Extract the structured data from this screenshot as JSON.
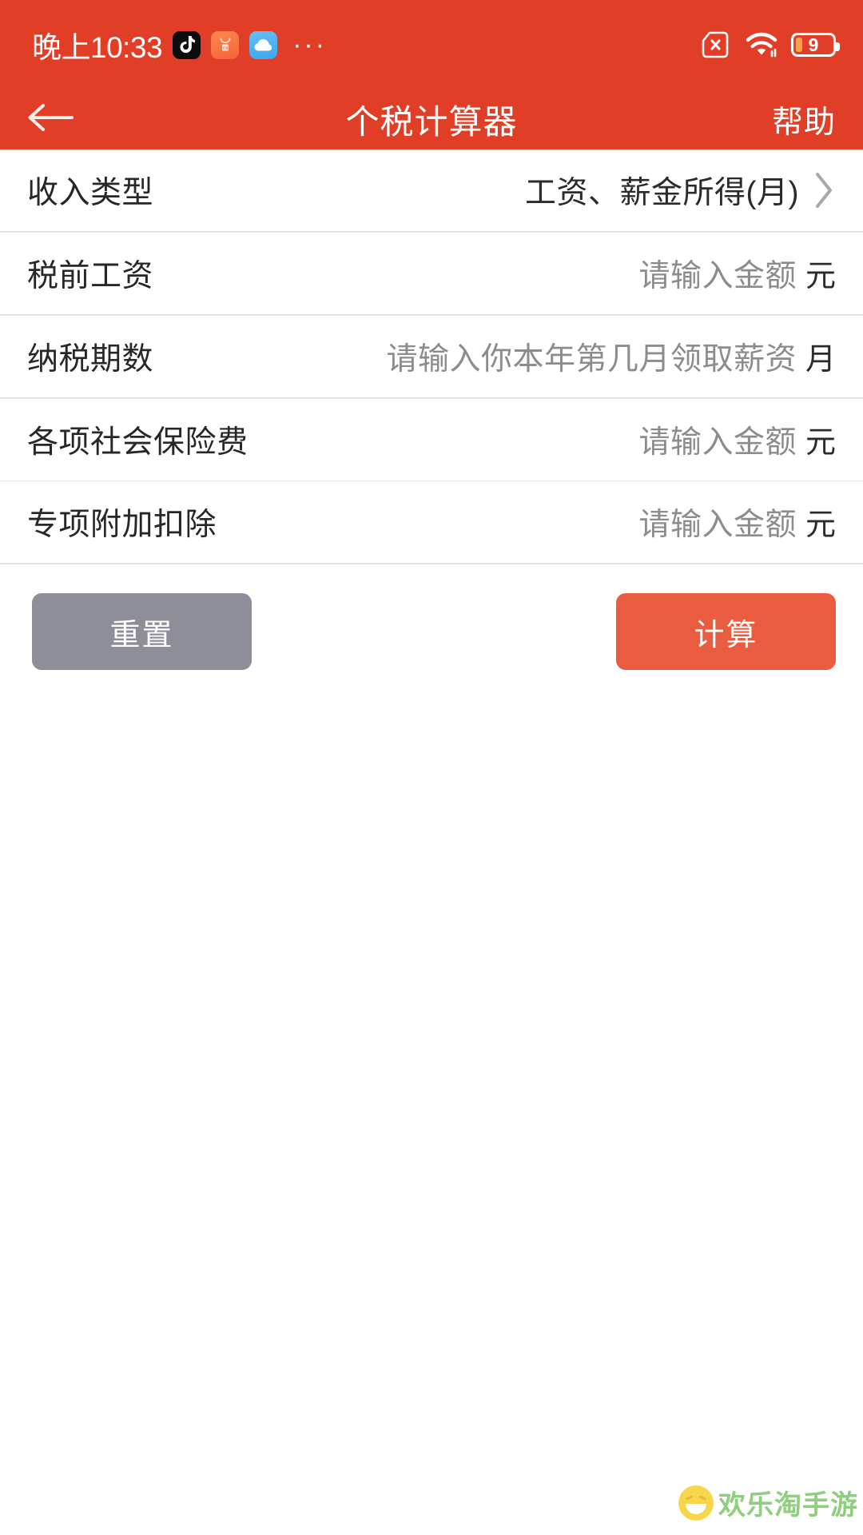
{
  "status_bar": {
    "clock": "晚上10:33",
    "app_icons": [
      {
        "name": "tiktok-app-icon"
      },
      {
        "name": "xiaomi-store-app-icon"
      },
      {
        "name": "cloud-app-icon"
      }
    ],
    "more_dots": "···",
    "sim_icon": "sim-card-disabled-icon",
    "wifi_icon": "wifi-icon",
    "battery_level": "9",
    "battery_icon": "battery-icon"
  },
  "nav": {
    "back_icon": "back-arrow-icon",
    "title": "个税计算器",
    "help_label": "帮助"
  },
  "form": {
    "rows": [
      {
        "label": "收入类型",
        "value": "工资、薪金所得(月)",
        "placeholder": "",
        "unit": "",
        "chevron": "chevron-right-icon",
        "type": "select"
      },
      {
        "label": "税前工资",
        "value": "",
        "placeholder": "请输入金额",
        "unit": "元",
        "chevron": "",
        "type": "input"
      },
      {
        "label": "纳税期数",
        "value": "",
        "placeholder": "请输入你本年第几月领取薪资",
        "unit": "月",
        "chevron": "",
        "type": "input"
      },
      {
        "label": "各项社会保险费",
        "value": "",
        "placeholder": "请输入金额",
        "unit": "元",
        "chevron": "",
        "type": "input"
      },
      {
        "label": "专项附加扣除",
        "value": "",
        "placeholder": "请输入金额",
        "unit": "元",
        "chevron": "",
        "type": "input"
      }
    ]
  },
  "actions": {
    "reset_label": "重置",
    "calculate_label": "计算"
  },
  "watermark": {
    "text": "欢乐淘手游",
    "face_icon": "smiley-face-icon"
  },
  "colors": {
    "header_red": "#E03E26",
    "calculate_button": "#E95C3F",
    "reset_button": "#8E8E98",
    "battery_fill": "#F7A24B",
    "watermark_green": "#8FCE7E",
    "watermark_yellow": "#F7D64A",
    "label_text": "#272727",
    "placeholder_text": "#8C8C8C",
    "separator": "#E6E6E6"
  }
}
